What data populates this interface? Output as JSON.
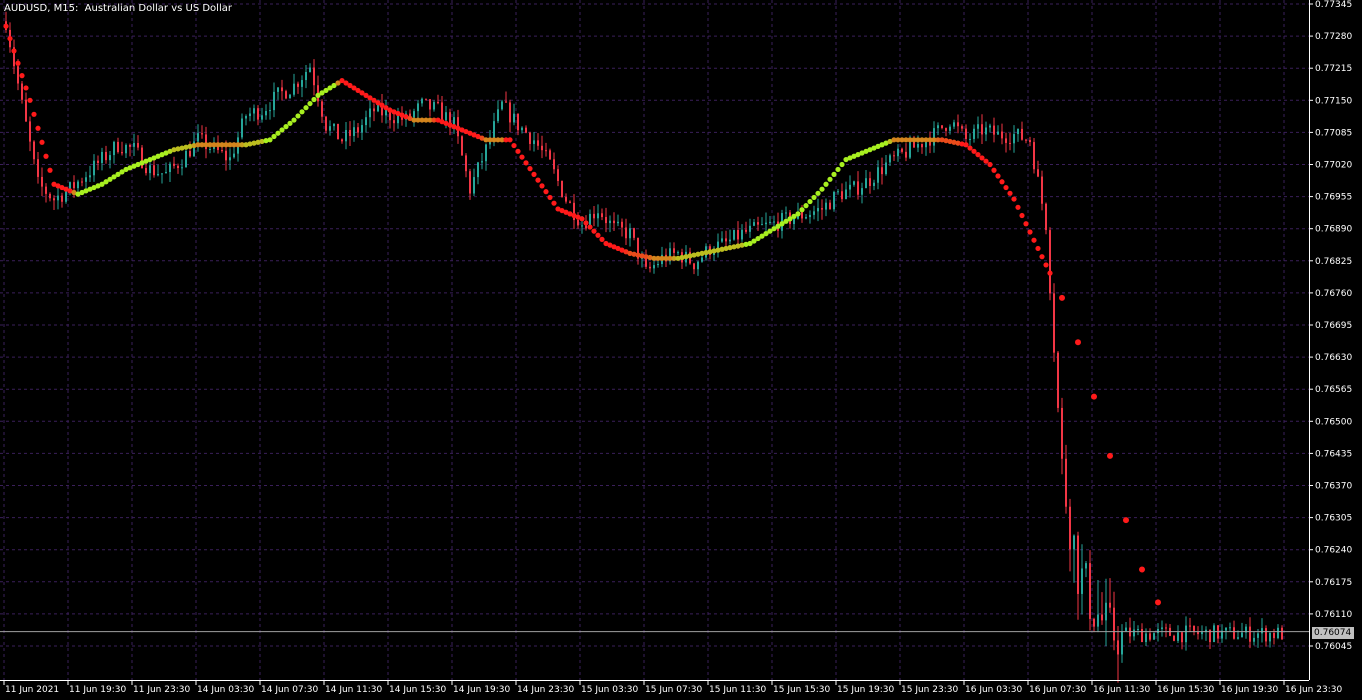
{
  "window": {
    "symbol_line": "AUDUSD, M15:  Australian Dollar vs US Dollar"
  },
  "colors": {
    "background": "#000000",
    "grid": "#3a1f5a",
    "axis_text": "#ffffff",
    "bull_candle": "#26a69a",
    "bear_candle": "#f23645",
    "ma_rising": "#a8f020",
    "ma_falling": "#ff1a1a",
    "price_line": "#a0a0a0",
    "price_tag_bg": "#c0c0c0"
  },
  "chart_data": {
    "type": "line",
    "title": "",
    "symbol": "AUDUSD",
    "timeframe": "M15",
    "instrument": "Australian Dollar vs US Dollar",
    "current_price": "0.76074",
    "y_ticks": [
      "0.77345",
      "0.77280",
      "0.77215",
      "0.77150",
      "0.77085",
      "0.77020",
      "0.76955",
      "0.76890",
      "0.76825",
      "0.76760",
      "0.76695",
      "0.76630",
      "0.76565",
      "0.76500",
      "0.76435",
      "0.76370",
      "0.76305",
      "0.76240",
      "0.76175",
      "0.76110",
      "0.76045"
    ],
    "ylim": [
      0.7601,
      0.7735
    ],
    "x_ticks": [
      "11 Jun 2021",
      "11 Jun 19:30",
      "11 Jun 23:30",
      "14 Jun 03:30",
      "14 Jun 07:30",
      "14 Jun 11:30",
      "14 Jun 15:30",
      "14 Jun 19:30",
      "14 Jun 23:30",
      "15 Jun 03:30",
      "15 Jun 07:30",
      "15 Jun 11:30",
      "15 Jun 15:30",
      "15 Jun 19:30",
      "15 Jun 23:30",
      "16 Jun 03:30",
      "16 Jun 07:30",
      "16 Jun 11:30",
      "16 Jun 15:30",
      "16 Jun 19:30",
      "16 Jun 23:30"
    ],
    "grid": true,
    "series": [
      {
        "kind": "price",
        "x_index": [
          0,
          4,
          8,
          12,
          16,
          20,
          24,
          28,
          32,
          36,
          40,
          44,
          48,
          52,
          56,
          60,
          64,
          68,
          72,
          76,
          80,
          84,
          88,
          92,
          96,
          100,
          104,
          108,
          112,
          116,
          120,
          124,
          128,
          132,
          136,
          140,
          144,
          148,
          152,
          156,
          160,
          164,
          168,
          172,
          176,
          180,
          184,
          188,
          192,
          196,
          200,
          204,
          208,
          212,
          216,
          220,
          224,
          228,
          232,
          236,
          240,
          244,
          248,
          252,
          256,
          260,
          264,
          268,
          272,
          276,
          280,
          284,
          288,
          296,
          304,
          312,
          320
        ],
        "values": [
          0.7731,
          0.7714,
          0.7698,
          0.7695,
          0.7697,
          0.77,
          0.7703,
          0.7706,
          0.7705,
          0.7701,
          0.77,
          0.7703,
          0.7707,
          0.7705,
          0.7703,
          0.7712,
          0.7713,
          0.7716,
          0.7718,
          0.7722,
          0.771,
          0.7707,
          0.7709,
          0.7713,
          0.7712,
          0.7711,
          0.7714,
          0.7713,
          0.771,
          0.7697,
          0.7705,
          0.7714,
          0.771,
          0.7707,
          0.7702,
          0.7695,
          0.769,
          0.7693,
          0.7689,
          0.7688,
          0.768,
          0.7683,
          0.7684,
          0.7682,
          0.7685,
          0.7686,
          0.7688,
          0.7689,
          0.769,
          0.7691,
          0.7692,
          0.7693,
          0.7696,
          0.7697,
          0.7699,
          0.7702,
          0.7704,
          0.7706,
          0.7708,
          0.7711,
          0.7707,
          0.7709,
          0.7708,
          0.7708,
          0.7707,
          0.769,
          0.764,
          0.762,
          0.7612,
          0.7607,
          0.7607,
          0.7607,
          0.7607,
          0.7607,
          0.7607,
          0.7607,
          0.7607
        ]
      },
      {
        "kind": "moving_average",
        "x_index": [
          0,
          6,
          12,
          18,
          24,
          30,
          36,
          42,
          48,
          54,
          60,
          66,
          72,
          78,
          84,
          90,
          96,
          102,
          108,
          114,
          120,
          126,
          132,
          138,
          144,
          150,
          156,
          162,
          168,
          174,
          180,
          186,
          192,
          198,
          204,
          210,
          216,
          222,
          228,
          234,
          240,
          246,
          252,
          258,
          264,
          268,
          272,
          276,
          280,
          284,
          290
        ],
        "values": [
          0.773,
          0.7715,
          0.7698,
          0.7696,
          0.7698,
          0.7701,
          0.7703,
          0.7705,
          0.7706,
          0.7706,
          0.7706,
          0.7707,
          0.7711,
          0.7716,
          0.7719,
          0.7716,
          0.7713,
          0.7711,
          0.7711,
          0.7709,
          0.7707,
          0.7707,
          0.77,
          0.7693,
          0.7691,
          0.7686,
          0.7684,
          0.7683,
          0.7683,
          0.7684,
          0.7685,
          0.7686,
          0.7689,
          0.7692,
          0.7697,
          0.7703,
          0.7705,
          0.7707,
          0.7707,
          0.7707,
          0.7706,
          0.7702,
          0.7695,
          0.7685,
          0.7675,
          0.7666,
          0.7655,
          0.7643,
          0.763,
          0.762,
          0.761
        ]
      }
    ]
  }
}
